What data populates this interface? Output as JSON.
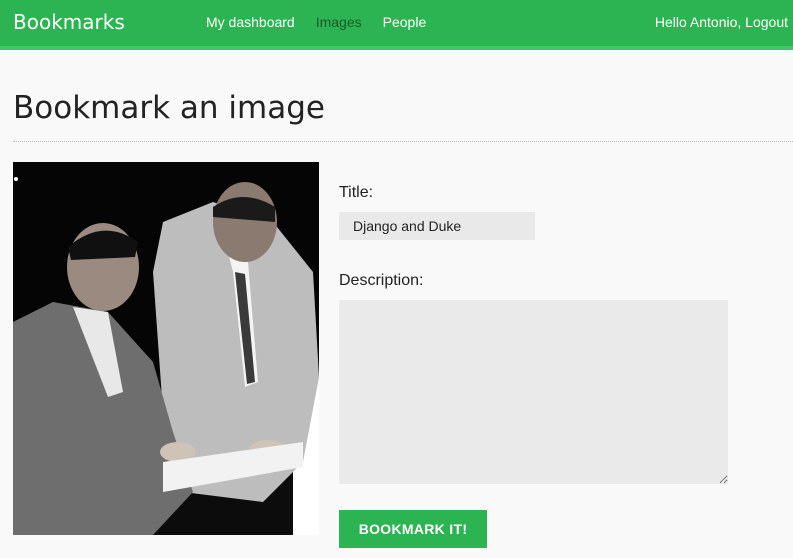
{
  "header": {
    "logo": "Bookmarks",
    "menu": [
      "My dashboard",
      "Images",
      "People"
    ],
    "greeting": "Hello Antonio,",
    "logout": "Logout"
  },
  "page": {
    "title": "Bookmark an image"
  },
  "form": {
    "title_label": "Title:",
    "title_value": "Django and Duke",
    "description_label": "Description:",
    "description_value": "",
    "submit_label": "BOOKMARK IT!"
  },
  "colors": {
    "brand_green": "#2db452",
    "selected_menu": "#1c5a2c"
  }
}
